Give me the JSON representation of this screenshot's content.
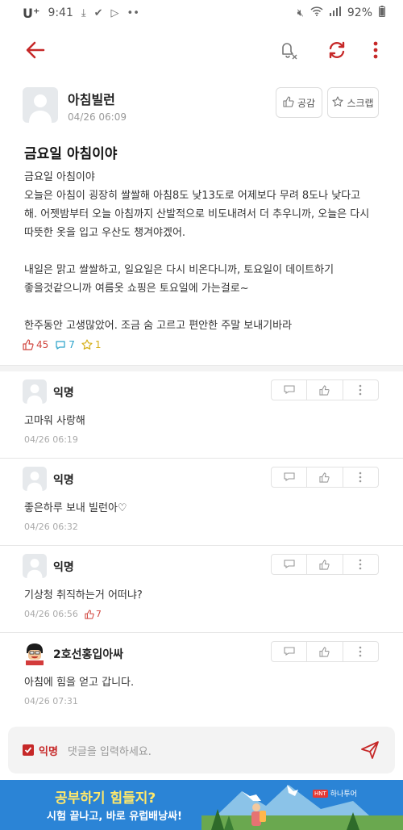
{
  "status_bar": {
    "carrier": "U⁺",
    "time": "9:41",
    "battery": "92%"
  },
  "post": {
    "author": "아침빌런",
    "date": "04/26 06:09",
    "like_button": "공감",
    "scrap_button": "스크랩",
    "title": "금요일 아침이야",
    "body": "금요일 아침이야\n오늘은 아침이 굉장히 쌀쌀해 아침8도 낮13도로 어제보다 무려 8도나 낮다고\n해. 어젯밤부터 오늘 아침까지 산발적으로 비도내려서 더 추우니까, 오늘은 다시\n따뜻한 옷을 입고 우산도 챙겨야겠어.\n\n내일은 맑고 쌀쌀하고, 일요일은 다시 비온다니까, 토요일이 데이트하기\n좋을것같으니까 여름옷 쇼핑은 토요일에 가는걸로~\n\n한주동안 고생많았어. 조금 숨 고르고 편안한 주말 보내기바라",
    "likes": "45",
    "comments": "7",
    "scraps": "1"
  },
  "comments": [
    {
      "name": "익명",
      "text": "고마워 사랑해",
      "date": "04/26 06:19",
      "votes": ""
    },
    {
      "name": "익명",
      "text": "좋은하루 보내 빌런아♡",
      "date": "04/26 06:32",
      "votes": ""
    },
    {
      "name": "익명",
      "text": "기상청 취직하는거 어떠냐?",
      "date": "04/26 06:56",
      "votes": "7"
    },
    {
      "name": "2호선홍입아싸",
      "text": "아침에 힘을 얻고 갑니다.",
      "date": "04/26 07:31",
      "votes": ""
    }
  ],
  "comment_input": {
    "anon_label": "익명",
    "placeholder": "댓글을 입력하세요."
  },
  "ad": {
    "headline": "공부하기 힘들지?",
    "subline": "시험 끝나고, 바로 유럽배낭싸!",
    "brand": "하나투어",
    "brand_tag": "HNT"
  },
  "colors": {
    "accent": "#c62828",
    "like": "#d1463f",
    "comment": "#2aa2c9",
    "scrap": "#d6b11d",
    "ad_bg": "#2b84d6"
  }
}
